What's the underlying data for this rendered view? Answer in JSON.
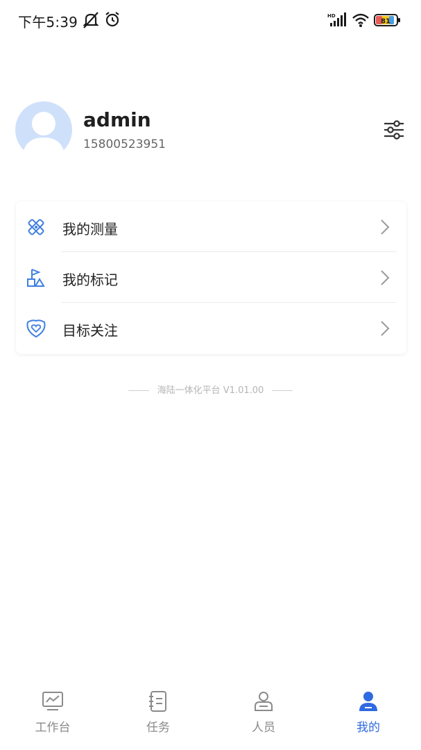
{
  "status_bar": {
    "time": "下午5:39",
    "icons": [
      "mute-icon",
      "alarm-icon",
      "hd-signal-icon",
      "wifi-icon",
      "battery-icon"
    ],
    "battery_level": "81"
  },
  "profile": {
    "name": "admin",
    "phone": "15800523951",
    "avatar_icon": "avatar-placeholder-icon",
    "settings_icon": "sliders-icon"
  },
  "menu": {
    "items": [
      {
        "label": "我的测量",
        "icon": "measure-icon"
      },
      {
        "label": "我的标记",
        "icon": "flag-mark-icon"
      },
      {
        "label": "目标关注",
        "icon": "heart-shield-icon"
      }
    ]
  },
  "footer": {
    "version": "海陆一体化平台 V1.01.00"
  },
  "tab_bar": {
    "active": 3,
    "tabs": [
      {
        "label": "工作台",
        "icon": "dashboard-icon"
      },
      {
        "label": "任务",
        "icon": "task-icon"
      },
      {
        "label": "人员",
        "icon": "personnel-icon"
      },
      {
        "label": "我的",
        "icon": "me-icon"
      }
    ]
  },
  "colors": {
    "accent": "#2f6ae0",
    "avatar_bg": "#cfe0fb",
    "icon_blue": "#3f7fe0",
    "inactive": "#8a8a8a"
  }
}
